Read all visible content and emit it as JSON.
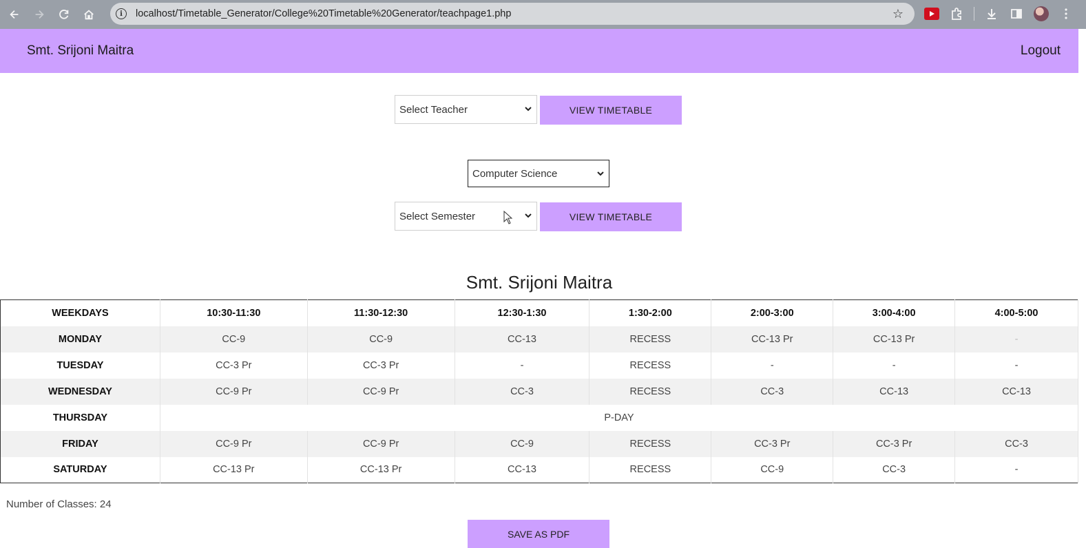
{
  "browser": {
    "url": "localhost/Timetable_Generator/College%20Timetable%20Generator/teachpage1.php",
    "icons": [
      "back-icon",
      "forward-icon",
      "reload-icon",
      "home-icon",
      "site-info-icon",
      "bookmark-star-icon",
      "youtube-extension-icon",
      "extensions-puzzle-icon",
      "download-icon",
      "side-panel-icon",
      "profile-avatar",
      "menu-kebab-icon"
    ]
  },
  "header": {
    "user_name": "Smt. Srijoni Maitra",
    "logout_label": "Logout",
    "background": "#cc9fff"
  },
  "teacher_form": {
    "select_value": "Select Teacher",
    "button_label": "VIEW TIMETABLE"
  },
  "department_select": {
    "value": "Computer Science"
  },
  "semester_form": {
    "select_value": "Select Semester",
    "button_label": "VIEW TIMETABLE"
  },
  "timetable": {
    "title": "Smt. Srijoni Maitra",
    "headers": [
      "WEEKDAYS",
      "10:30-11:30",
      "11:30-12:30",
      "12:30-1:30",
      "1:30-2:00",
      "2:00-3:00",
      "3:00-4:00",
      "4:00-5:00"
    ],
    "rows": [
      {
        "day": "MONDAY",
        "cells": [
          "CC-9",
          "CC-9",
          "CC-13",
          "RECESS",
          "CC-13 Pr",
          "CC-13 Pr",
          "-"
        ]
      },
      {
        "day": "TUESDAY",
        "cells": [
          "CC-3 Pr",
          "CC-3 Pr",
          "-",
          "RECESS",
          "-",
          "-",
          "-"
        ]
      },
      {
        "day": "WEDNESDAY",
        "cells": [
          "CC-9 Pr",
          "CC-9 Pr",
          "CC-3",
          "RECESS",
          "CC-3",
          "CC-13",
          "CC-13"
        ]
      },
      {
        "day": "THURSDAY",
        "merged": "P-DAY"
      },
      {
        "day": "FRIDAY",
        "cells": [
          "CC-9 Pr",
          "CC-9 Pr",
          "CC-9",
          "RECESS",
          "CC-3 Pr",
          "CC-3 Pr",
          "CC-3"
        ]
      },
      {
        "day": "SATURDAY",
        "cells": [
          "CC-13 Pr",
          "CC-13 Pr",
          "CC-13",
          "RECESS",
          "CC-9",
          "CC-3",
          "-"
        ]
      }
    ]
  },
  "summary": {
    "classes_text": "Number of Classes: 24"
  },
  "actions": {
    "save_pdf_label": "SAVE AS PDF"
  }
}
